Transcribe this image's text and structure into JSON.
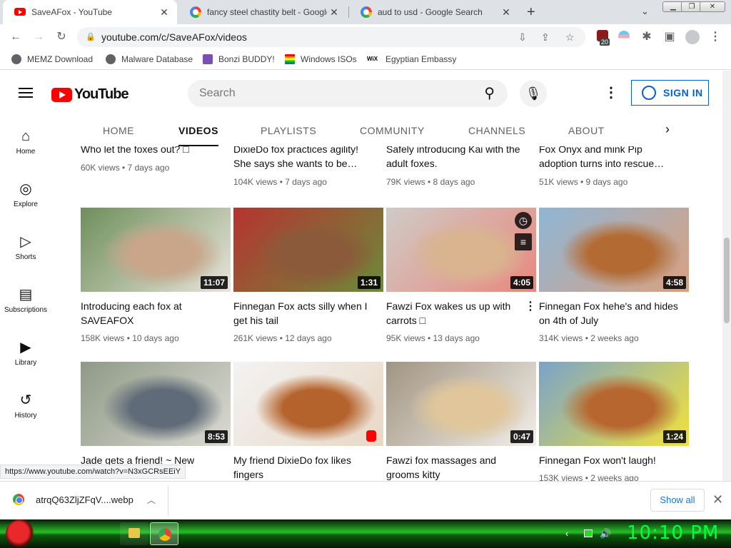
{
  "browser": {
    "tabs": [
      {
        "title": "SaveAFox - YouTube",
        "favicon": "youtube-favicon",
        "active": true
      },
      {
        "title": "fancy steel chastity belt - Google",
        "favicon": "google-favicon",
        "active": false
      },
      {
        "title": "aud to usd - Google Search",
        "favicon": "google-favicon",
        "active": false
      }
    ],
    "new_tab_glyph": "+",
    "tab_close_glyph": "✕",
    "url": "youtube.com/c/SaveAFox/videos",
    "extension_badge": "20",
    "bookmarks": [
      {
        "label": "MEMZ Download",
        "icon": "globe-icon"
      },
      {
        "label": "Malware Database",
        "icon": "globe-icon"
      },
      {
        "label": "Bonzi BUDDY!",
        "icon": "bonzi-icon"
      },
      {
        "label": "Windows ISOs",
        "icon": "windows-icon"
      },
      {
        "label": "Egyptian Embassy",
        "icon": "wix-icon"
      }
    ]
  },
  "youtube": {
    "logo_text": "YouTube",
    "search_placeholder": "Search",
    "signin_label": "SIGN IN",
    "channel_tabs": [
      "HOME",
      "VIDEOS",
      "PLAYLISTS",
      "COMMUNITY",
      "CHANNELS",
      "ABOUT"
    ],
    "active_tab": "VIDEOS",
    "sidebar": [
      {
        "label": "Home",
        "icon": "home-icon"
      },
      {
        "label": "Explore",
        "icon": "compass-icon"
      },
      {
        "label": "Shorts",
        "icon": "shorts-icon"
      },
      {
        "label": "Subscriptions",
        "icon": "subscriptions-icon"
      },
      {
        "label": "Library",
        "icon": "library-icon"
      },
      {
        "label": "History",
        "icon": "history-icon"
      }
    ],
    "top_row": [
      {
        "title": "Who let the foxes out? □",
        "meta": "60K views • 7 days ago"
      },
      {
        "title": "DixieDo fox practices agility! She says she wants to be…",
        "meta": "104K views • 7 days ago"
      },
      {
        "title": "Safely introducing Kai with the adult foxes.",
        "meta": "79K views • 8 days ago"
      },
      {
        "title": "Fox Onyx and mink Pip adoption turns into rescue…",
        "meta": "51K views • 9 days ago"
      }
    ],
    "videos": [
      {
        "title": "Introducing each fox at SAVEAFOX",
        "meta": "158K views • 10 days ago",
        "duration": "11:07",
        "palette": [
          "#6e8f5a",
          "#c9a58a",
          "#e9e4dc"
        ]
      },
      {
        "title": "Finnegan Fox acts silly when I get his tail",
        "meta": "261K views • 12 days ago",
        "duration": "1:31",
        "palette": [
          "#b7332f",
          "#8a5a3a",
          "#6b8b3a"
        ]
      },
      {
        "title": "Fawzi Fox wakes us up with carrots □",
        "meta": "95K views • 13 days ago",
        "duration": "4:05",
        "palette": [
          "#cfcbc6",
          "#d9b48f",
          "#e9877d"
        ]
      },
      {
        "title": "Finnegan Fox hehe's and hides on 4th of July",
        "meta": "314K views • 2 weeks ago",
        "duration": "4:58",
        "palette": [
          "#8fb6d6",
          "#b36b33",
          "#d9a07f"
        ]
      },
      {
        "title": "Jade gets a friend! ~ New",
        "meta": "",
        "duration": "8:53",
        "palette": [
          "#8f9a86",
          "#5f6b78",
          "#dcdad4"
        ]
      },
      {
        "title": "My friend DixieDo fox likes fingers",
        "meta": "",
        "duration": "",
        "palette": [
          "#f3f3f3",
          "#b5632c",
          "#e8d7c4"
        ]
      },
      {
        "title": "Fawzi fox massages and grooms kitty",
        "meta": "",
        "duration": "0:47",
        "palette": [
          "#a19482",
          "#e0c69a",
          "#f2efe9"
        ]
      },
      {
        "title": "Finnegan Fox won't laugh!",
        "meta": "153K views • 2 weeks ago",
        "duration": "1:24",
        "palette": [
          "#7aa3c9",
          "#b8662f",
          "#f2e23a"
        ]
      }
    ],
    "status_url": "https://www.youtube.com/watch?v=N3xGCRsEEiY"
  },
  "downloads": {
    "file": "atrqQ63ZljZFqV....webp",
    "show_all": "Show all"
  },
  "taskbar": {
    "clock": "10:10 PM"
  }
}
